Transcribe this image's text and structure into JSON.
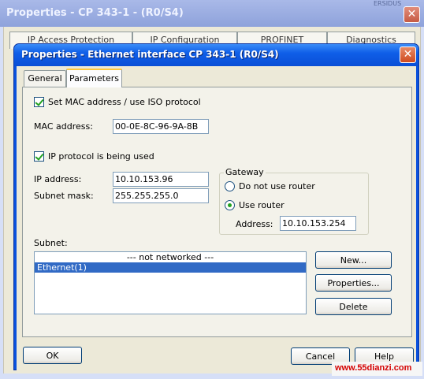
{
  "background_window": {
    "title": "Properties - CP 343-1 - (R0/S4)",
    "corner_text": "ERSIDUS",
    "tabs": [
      "IP Access Protection",
      "IP Configuration",
      "PROFINET",
      "Diagnostics"
    ]
  },
  "dialog": {
    "title": "Properties - Ethernet interface  CP 343-1 (R0/S4)",
    "tabs": [
      {
        "label": "General",
        "active": false
      },
      {
        "label": "Parameters",
        "active": true
      }
    ],
    "set_mac": {
      "label": "Set MAC address / use ISO protocol",
      "checked": true
    },
    "mac_address": {
      "label": "MAC address:",
      "value": "00-0E-8C-96-9A-8B"
    },
    "ip_protocol": {
      "label": "IP protocol is being used",
      "checked": true
    },
    "ip_address": {
      "label": "IP address:",
      "value": "10.10.153.96"
    },
    "subnet_mask": {
      "label": "Subnet mask:",
      "value": "255.255.255.0"
    },
    "gateway": {
      "title": "Gateway",
      "do_not_use_router": {
        "label": "Do not use router",
        "selected": false
      },
      "use_router": {
        "label": "Use router",
        "selected": true
      },
      "address": {
        "label": "Address:",
        "value": "10.10.153.254"
      }
    },
    "subnet": {
      "label": "Subnet:",
      "items": [
        {
          "label": "--- not networked ---",
          "selected": false
        },
        {
          "label": "Ethernet(1)",
          "selected": true
        }
      ]
    },
    "buttons": {
      "new": "New...",
      "properties": "Properties...",
      "delete": "Delete",
      "ok": "OK",
      "cancel": "Cancel",
      "help": "Help"
    }
  },
  "watermark": "www.55dianzi.com",
  "colors": {
    "title_blue": "#0a52de",
    "selection": "#316ac5",
    "check_green": "#21a121",
    "close_red": "#cf4a1f"
  }
}
